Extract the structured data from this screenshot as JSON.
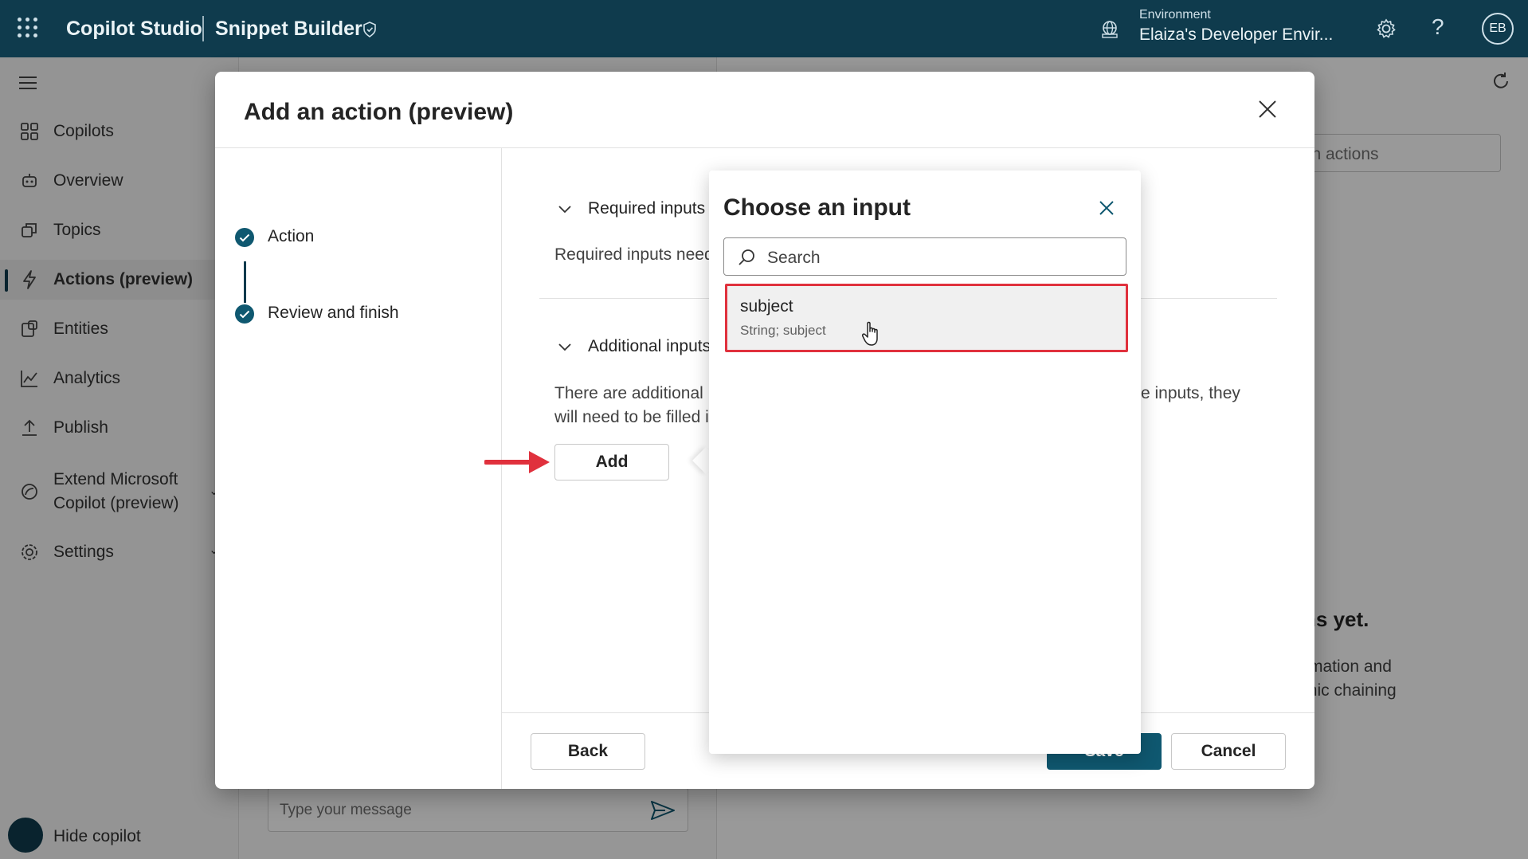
{
  "topbar": {
    "app_title": "Copilot Studio",
    "app_subtitle": "Snippet Builder",
    "environment_label": "Environment",
    "environment_value": "Elaiza's Developer Envir...",
    "help_glyph": "?",
    "avatar_initials": "EB"
  },
  "sidebar": {
    "items": [
      {
        "label": "Copilots",
        "icon": "grid-icon"
      },
      {
        "label": "Overview",
        "icon": "bot-icon"
      },
      {
        "label": "Topics",
        "icon": "topics-icon"
      },
      {
        "label": "Actions (preview)",
        "icon": "lightning-icon",
        "active": true
      },
      {
        "label": "Entities",
        "icon": "entities-icon"
      },
      {
        "label": "Analytics",
        "icon": "chart-icon"
      },
      {
        "label": "Publish",
        "icon": "upload-icon"
      },
      {
        "label": "Extend Microsoft",
        "label2": "Copilot (preview)",
        "icon": "copilot-icon"
      },
      {
        "label": "Settings",
        "icon": "gear-icon"
      }
    ],
    "hide_copilot": "Hide copilot"
  },
  "chat": {
    "placeholder": "Type your message"
  },
  "background": {
    "search_partial": "rch actions",
    "heading_partial": "ns yet.",
    "text_line1_partial": "rmation and",
    "text_line2_partial": "mic chaining"
  },
  "dialog": {
    "title": "Add an action (preview)",
    "steps": [
      {
        "label": "Action",
        "completed": true
      },
      {
        "label": "Review and finish",
        "completed": true
      }
    ],
    "required_section": {
      "title": "Required inputs",
      "text": "Required inputs need"
    },
    "additional_section": {
      "title": "Additional inputs",
      "text_line1": "There are additional i",
      "text_line1_tail": "e inputs, they",
      "text_line2": "will need to be filled i",
      "add_button": "Add"
    },
    "footer": {
      "back": "Back",
      "save": "Save",
      "cancel": "Cancel"
    }
  },
  "popover": {
    "title": "Choose an input",
    "search_placeholder": "Search",
    "items": [
      {
        "name": "subject",
        "type": "String; subject"
      }
    ]
  },
  "colors": {
    "topbar": "#0f3b4d",
    "primary": "#0f5870",
    "highlight": "#e0313d"
  }
}
